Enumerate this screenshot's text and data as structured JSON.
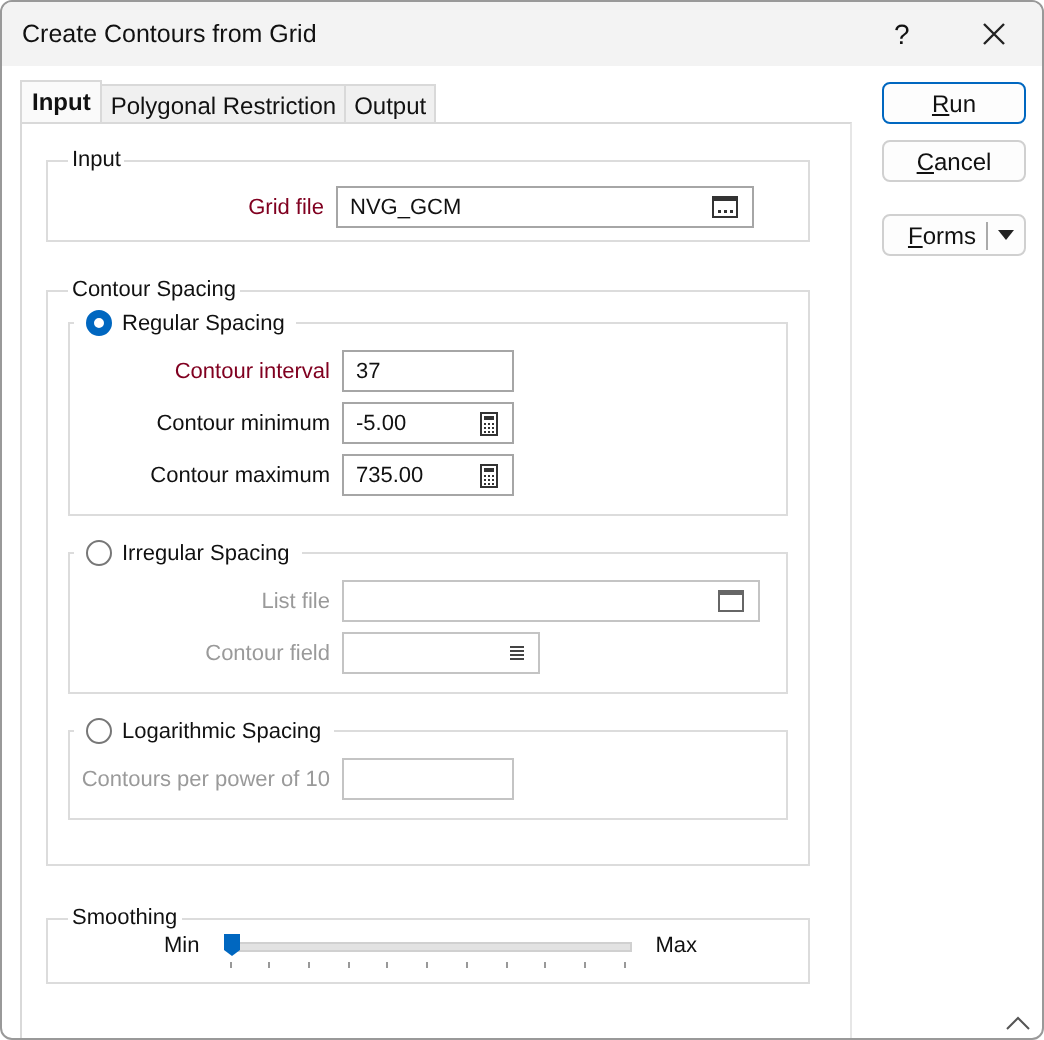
{
  "window": {
    "title": "Create Contours from Grid",
    "help": "?"
  },
  "tabs": [
    {
      "label": "Input",
      "selected": true
    },
    {
      "label": "Polygonal Restriction",
      "selected": false
    },
    {
      "label": "Output",
      "selected": false
    }
  ],
  "input_group": {
    "title": "Input",
    "fields": [
      {
        "label": "Grid file",
        "value": "NVG_GCM",
        "required": true,
        "kind": "file"
      }
    ]
  },
  "contour_spacing": {
    "title": "Contour Spacing",
    "options": [
      {
        "label": "Regular Spacing",
        "selected": true,
        "fields": [
          {
            "label": "Contour interval",
            "value": "37",
            "required": true,
            "kind": "text"
          },
          {
            "label": "Contour minimum",
            "value": "-5.00",
            "required": false,
            "kind": "number"
          },
          {
            "label": "Contour maximum",
            "value": "735.00",
            "required": false,
            "kind": "number"
          }
        ]
      },
      {
        "label": "Irregular Spacing",
        "selected": false,
        "fields": [
          {
            "label": "List file",
            "required": false,
            "kind": "path"
          },
          {
            "label": "Contour field",
            "required": false,
            "kind": "field"
          }
        ]
      },
      {
        "label": "Logarithmic Spacing",
        "selected": false,
        "fields": [
          {
            "label": "Contours per power of 10",
            "required": false,
            "kind": "text"
          }
        ]
      }
    ]
  },
  "smoothing": {
    "title": "Smoothing",
    "min": "Min",
    "max": "Max",
    "level": 0
  },
  "buttons": [
    {
      "label": "Run",
      "default": true,
      "dropdown": false
    },
    {
      "label": "Cancel",
      "default": false,
      "dropdown": false
    },
    {
      "label": "Forms",
      "default": false,
      "dropdown": true
    }
  ]
}
